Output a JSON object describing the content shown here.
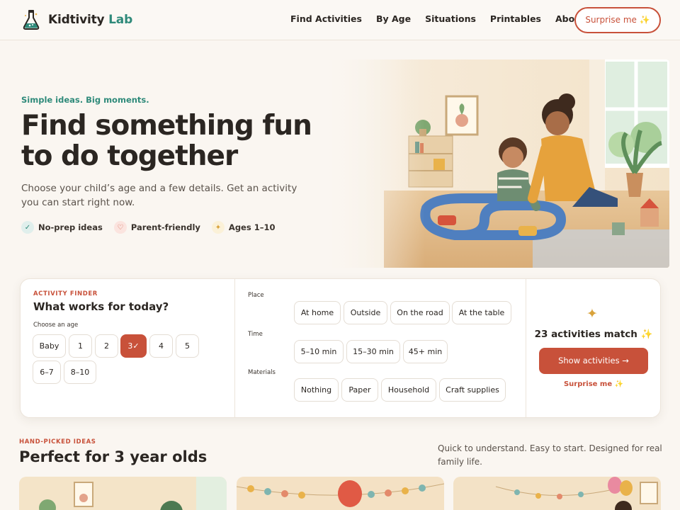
{
  "brand": {
    "name": "Kidtivity",
    "accent": "Lab",
    "logo_icon": "flask-icon",
    "color": "#2f8a7a"
  },
  "nav": [
    "Find Activities",
    "By Age",
    "Situations",
    "Printables",
    "About"
  ],
  "header_cta": "Surprise me ✨",
  "hero": {
    "tag": "Simple ideas. Big moments.",
    "title": "Find something fun to do together",
    "subtitle": "Choose your child’s age and a few details. Get an activity you can start right now.",
    "badges": [
      {
        "icon": "check-icon",
        "label": "No-prep ideas"
      },
      {
        "icon": "heart-icon",
        "label": "Parent-friendly"
      },
      {
        "icon": "sparkle-icon",
        "label": "Ages 1–10"
      }
    ]
  },
  "finder": {
    "eyebrow": "ACTIVITY FINDER",
    "title": "What works for today?",
    "age_label": "Choose an age",
    "ages": [
      "Baby",
      "1",
      "2",
      "3✓",
      "4",
      "5",
      "6–7",
      "8–10"
    ],
    "selected_age": "3",
    "place_label": "Place",
    "places": [
      "At home",
      "Outside",
      "On the road",
      "At the table"
    ],
    "time_label": "Time",
    "times": [
      "5–10 min",
      "15–30 min",
      "45+ min"
    ],
    "materials_label": "Materials",
    "materials": [
      "Nothing",
      "Paper",
      "Household",
      "Craft supplies"
    ],
    "match_text": "23 activities match ✨",
    "show_button": "Show activities →",
    "surprise_link": "Surprise me ✨"
  },
  "section": {
    "eyebrow": "HAND-PICKED IDEAS",
    "title": "Perfect for 3 year olds",
    "description": "Quick to understand. Easy to start. Designed for real family life."
  },
  "colors": {
    "primary": "#c8513a",
    "teal": "#2f8a7a",
    "background": "#faf6f1"
  }
}
